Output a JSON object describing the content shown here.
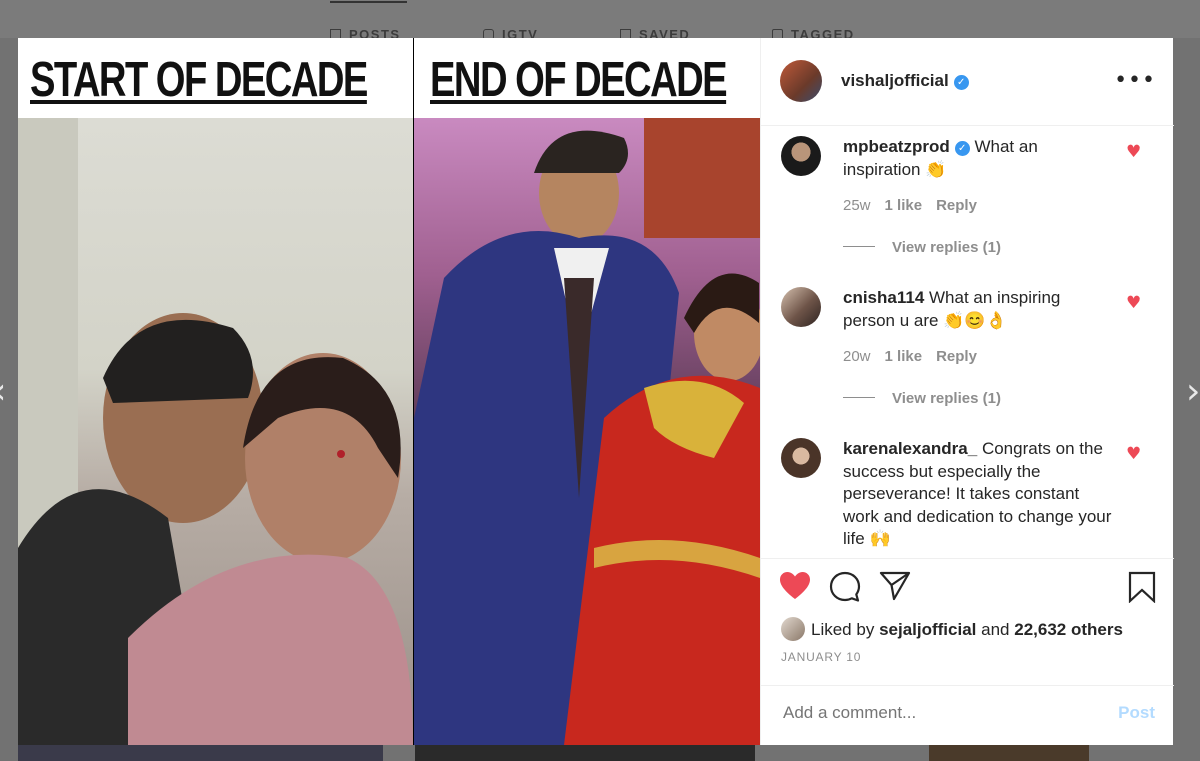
{
  "backdrop": {
    "tabs": [
      {
        "label": "POSTS",
        "icon": "grid-icon"
      },
      {
        "label": "IGTV",
        "icon": "igtv-icon"
      },
      {
        "label": "SAVED",
        "icon": "bookmark-icon"
      },
      {
        "label": "TAGGED",
        "icon": "tag-icon"
      }
    ]
  },
  "photo": {
    "left_caption": "START OF DECADE",
    "right_caption": "END OF DECADE"
  },
  "header": {
    "username": "vishaljofficial",
    "verified": true,
    "more_icon": "•••"
  },
  "comments": [
    {
      "username": "mpbeatzprod",
      "verified": true,
      "text": "What an inspiration 👏",
      "age": "25w",
      "likes": "1 like",
      "reply": "Reply",
      "view_replies": "View replies (1)",
      "liked": true
    },
    {
      "username": "cnisha114",
      "verified": false,
      "text": "What an inspiring person u are 👏😊👌",
      "age": "20w",
      "likes": "1 like",
      "reply": "Reply",
      "view_replies": "View replies (1)",
      "liked": true
    },
    {
      "username": "karenalexandra_",
      "verified": false,
      "text": "Congrats on the success but especially the perseverance! It takes constant work and dedication to change your life 🙌",
      "liked": true
    }
  ],
  "actions": {
    "liked_by_prefix": "Liked by",
    "liked_by_user": "sejaljofficial",
    "liked_by_and": "and",
    "liked_by_count": "22,632 others",
    "date": "JANUARY 10"
  },
  "add_comment": {
    "placeholder": "Add a comment...",
    "post_label": "Post"
  },
  "colors": {
    "like_red": "#ed4956",
    "verified_blue": "#3897f0",
    "post_disabled": "#b3dbff"
  }
}
